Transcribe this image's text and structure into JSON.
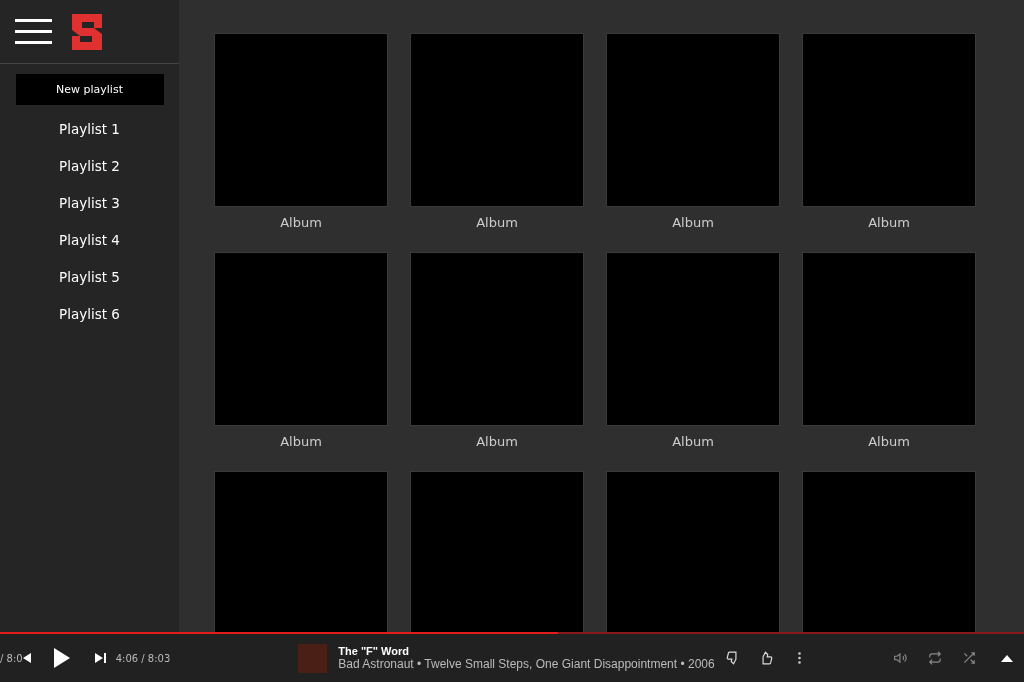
{
  "sidebar": {
    "new_playlist": "New playlist",
    "playlists": [
      "Playlist 1",
      "Playlist 2",
      "Playlist 3",
      "Playlist 4",
      "Playlist 5",
      "Playlist 6"
    ]
  },
  "albums": [
    {
      "kind": "full",
      "title": "Album"
    },
    {
      "kind": "full",
      "title": "Album"
    },
    {
      "kind": "full",
      "title": "Album"
    },
    {
      "kind": "full",
      "title": "Album"
    },
    {
      "kind": "full",
      "title": "Album"
    },
    {
      "kind": "full",
      "title": "Album"
    },
    {
      "kind": "full",
      "title": "Album"
    },
    {
      "kind": "full",
      "title": "Album"
    },
    {
      "kind": "cut"
    },
    {
      "kind": "cut"
    },
    {
      "kind": "cut"
    },
    {
      "kind": "cut"
    }
  ],
  "player": {
    "progress": {
      "level": 0.54
    },
    "clipped_time": "/ 8:0",
    "time": "4:06 / 8:03",
    "track_title": "The \"F\" Word",
    "track_info": "Bad Astronaut • Twelve Small Steps, One Giant Disappointment • 2006"
  }
}
